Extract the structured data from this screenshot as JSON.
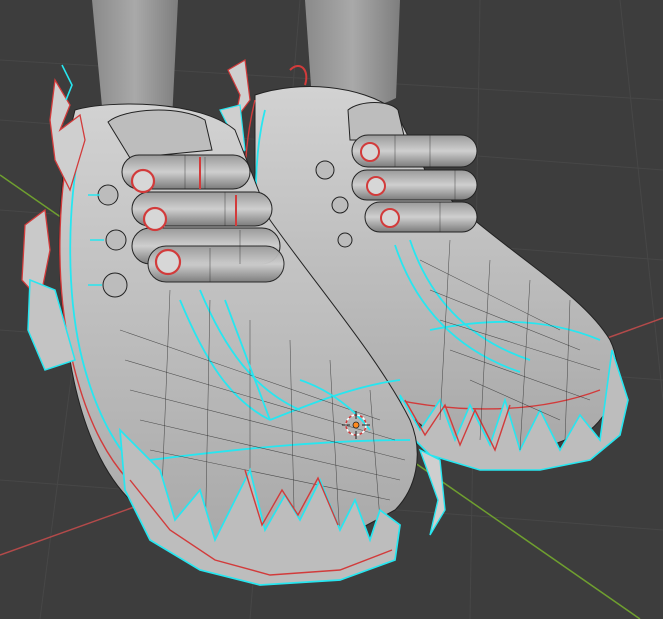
{
  "viewport": {
    "background": "#3d3d3d",
    "mesh_color": "#c9c9c9",
    "wire_color": "#2a2a2a",
    "seam_red": "#d23b3b",
    "seam_cyan": "#27e6f0",
    "x_axis_color": "#b34a4a",
    "y_axis_color": "#6f9f2f",
    "origin_color": "#ff8a1f"
  },
  "objects": {
    "legs": "legs",
    "left_shoe": "left-shoe",
    "right_shoe": "right-shoe"
  },
  "icons": {
    "object_origin": "object-origin-icon",
    "cursor_3d": "3d-cursor-icon"
  }
}
